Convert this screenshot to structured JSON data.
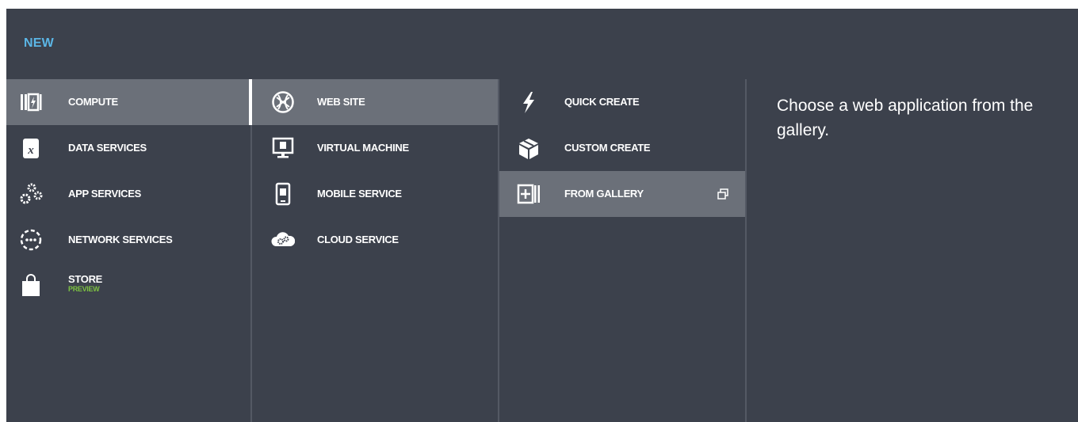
{
  "header": {
    "title": "NEW"
  },
  "categories": [
    {
      "label": "COMPUTE",
      "icon": "compute-icon",
      "selected": true
    },
    {
      "label": "DATA SERVICES",
      "icon": "data-services-icon"
    },
    {
      "label": "APP SERVICES",
      "icon": "gears-icon"
    },
    {
      "label": "NETWORK SERVICES",
      "icon": "network-icon"
    },
    {
      "label": "STORE",
      "sublabel": "PREVIEW",
      "icon": "shopping-bag-icon"
    }
  ],
  "services": [
    {
      "label": "WEB SITE",
      "icon": "globe-icon",
      "selected": true
    },
    {
      "label": "VIRTUAL MACHINE",
      "icon": "monitor-icon"
    },
    {
      "label": "MOBILE SERVICE",
      "icon": "phone-icon"
    },
    {
      "label": "CLOUD SERVICE",
      "icon": "cloud-gears-icon"
    }
  ],
  "actions": [
    {
      "label": "QUICK CREATE",
      "icon": "lightning-icon"
    },
    {
      "label": "CUSTOM CREATE",
      "icon": "box-icon"
    },
    {
      "label": "FROM GALLERY",
      "icon": "gallery-add-icon",
      "highlighted": true,
      "trailing_icon": "external-window-icon"
    }
  ],
  "description": {
    "text": "Choose a web application from the gallery."
  },
  "colors": {
    "background": "#3c414c",
    "selected": "#6b7079",
    "accent_title": "#5bb6e6",
    "preview_green": "#7dc242"
  }
}
